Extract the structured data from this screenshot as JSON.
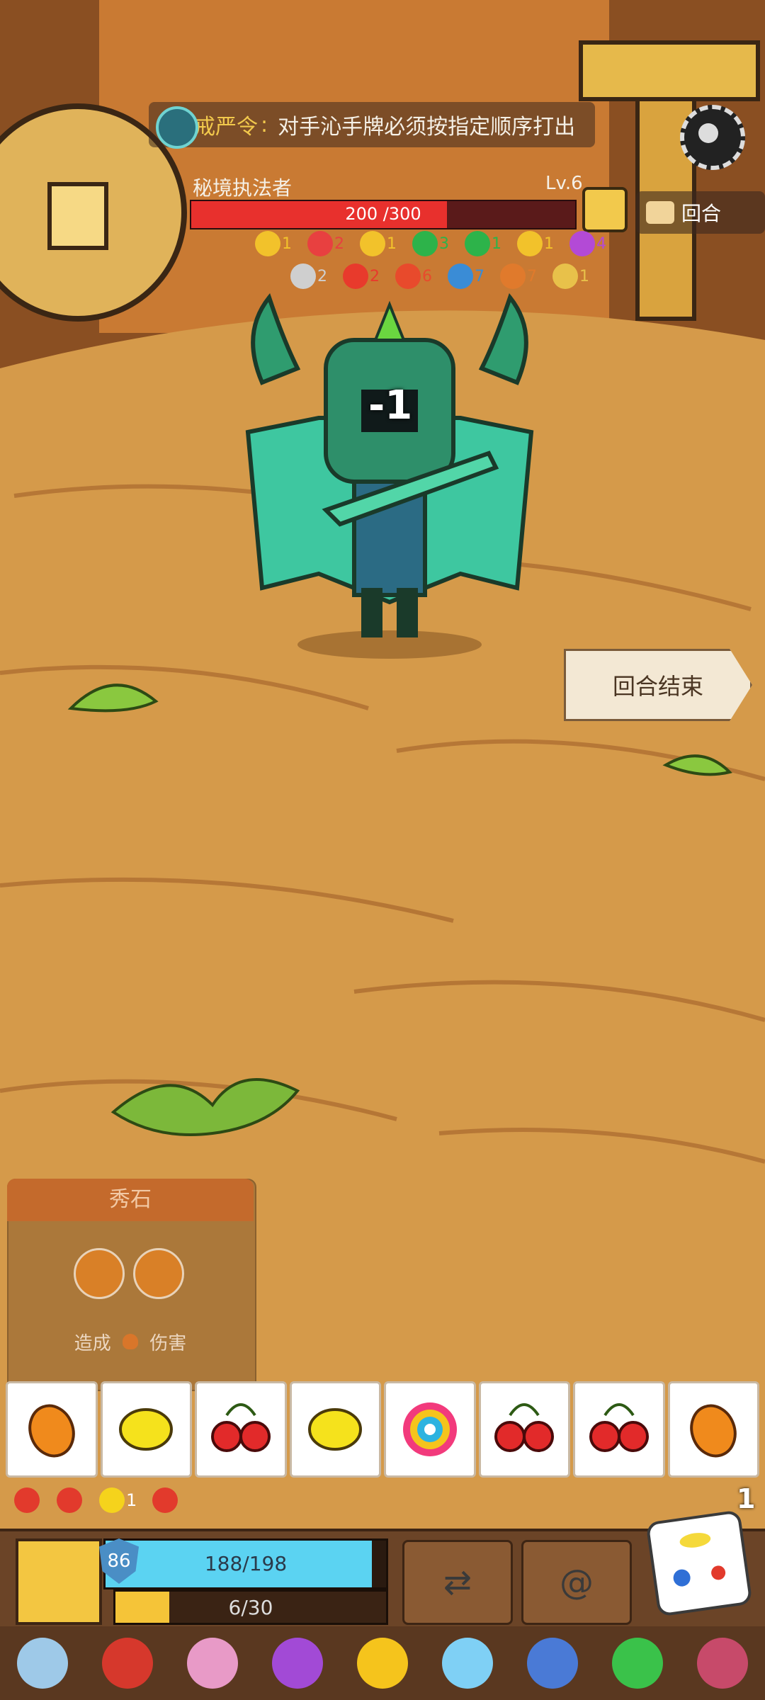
{
  "banner": {
    "tag": "戒严令",
    "separator": ":",
    "description": "对手沁手牌必须按指定顺序打出"
  },
  "enemy": {
    "name": "秘境执法者",
    "level": "Lv.6",
    "hp": "200 /300",
    "hp_ratio": 0.6667,
    "damage_popup": "-1"
  },
  "round_label": "回合",
  "end_turn_label": "回合结束",
  "enemy_status_row1": [
    {
      "icon": "shield-block-icon",
      "value": "1",
      "color": "#f2c22b"
    },
    {
      "icon": "heart-break-icon",
      "value": "2",
      "color": "#e84040"
    },
    {
      "icon": "shield-up-icon",
      "value": "1",
      "color": "#f2c22b"
    },
    {
      "icon": "swirl-icon",
      "value": "3",
      "color": "#2db34a"
    },
    {
      "icon": "swirl-up-icon",
      "value": "1",
      "color": "#2db34a"
    },
    {
      "icon": "triangle-icon",
      "value": "1",
      "color": "#f2c22b"
    },
    {
      "icon": "splat-icon",
      "value": "4",
      "color": "#b34ad6"
    }
  ],
  "enemy_status_row2": [
    {
      "icon": "skull-icon",
      "value": "2",
      "color": "#cfcfcf"
    },
    {
      "icon": "blood-drop-icon",
      "value": "2",
      "color": "#e83a2c"
    },
    {
      "icon": "fire-icon",
      "value": "6",
      "color": "#e84a2c"
    },
    {
      "icon": "speech-icon",
      "value": "7",
      "color": "#3a8cd6"
    },
    {
      "icon": "flame-icon",
      "value": "7",
      "color": "#e07a2c"
    },
    {
      "icon": "lock-icon",
      "value": "1",
      "color": "#e8c14a"
    }
  ],
  "panel": {
    "title": "秀石",
    "desc_prefix": "造成",
    "desc_suffix": "伤害"
  },
  "fruits": [
    "mango",
    "lemon",
    "cherry",
    "lemon",
    "rainbow",
    "cherry",
    "cherry",
    "mango"
  ],
  "player_status": [
    {
      "icon": "heart-shield-icon",
      "value": ""
    },
    {
      "icon": "target-icon",
      "value": ""
    },
    {
      "icon": "lightning-icon",
      "value": "1"
    },
    {
      "icon": "shield-check-icon",
      "value": ""
    }
  ],
  "dice_count": "1",
  "player": {
    "shield": "86",
    "hp": "188/198",
    "hp_ratio": 0.9495,
    "energy": "6/30",
    "energy_ratio": 0.2
  },
  "relics": [
    "bell-icon",
    "staff-icon",
    "d20-icon",
    "potion-icon",
    "heart-gem-icon",
    "crystal-icon",
    "battle-axe-icon",
    "emerald-icon",
    "heart-monster-icon"
  ]
}
